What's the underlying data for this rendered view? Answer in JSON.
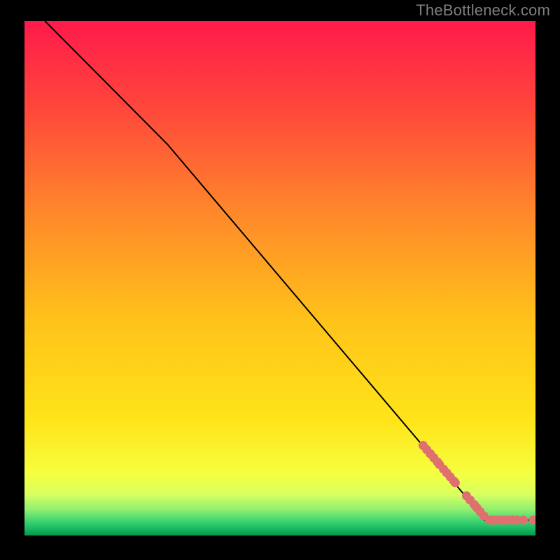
{
  "attribution": "TheBottleneck.com",
  "chart_data": {
    "type": "line",
    "title": "",
    "xlabel": "",
    "ylabel": "",
    "xlim": [
      0,
      100
    ],
    "ylim": [
      0,
      100
    ],
    "gradient_background": {
      "top_color": "#ff1a4b",
      "mid_color": "#ffe000",
      "green_band_start_color": "#e6ff66",
      "green_band_end_color": "#00c060",
      "bottom_color": "#00a050"
    },
    "curve": {
      "color": "#000000",
      "points_xy": [
        [
          4,
          100
        ],
        [
          28,
          76
        ],
        [
          86,
          8
        ],
        [
          90,
          3
        ],
        [
          100,
          3
        ]
      ]
    },
    "series": [
      {
        "name": "markers",
        "color": "#e07070",
        "points_xy": [
          [
            78,
            17.5
          ],
          [
            78.7,
            16.7
          ],
          [
            79.4,
            15.9
          ],
          [
            80.1,
            15.1
          ],
          [
            80.8,
            14.3
          ],
          [
            81.2,
            13.8
          ],
          [
            82.0,
            12.9
          ],
          [
            82.6,
            12.2
          ],
          [
            83.3,
            11.4
          ],
          [
            84.0,
            10.6
          ],
          [
            84.3,
            10.25
          ],
          [
            86.5,
            7.7
          ],
          [
            87.2,
            6.9
          ],
          [
            88.0,
            6.0
          ],
          [
            88.5,
            5.4
          ],
          [
            89.2,
            4.6
          ],
          [
            89.9,
            3.8
          ],
          [
            91.0,
            3.0
          ],
          [
            91.5,
            3.0
          ],
          [
            92.0,
            3.0
          ],
          [
            92.7,
            3.0
          ],
          [
            93.5,
            3.0
          ],
          [
            94.0,
            3.0
          ],
          [
            94.8,
            3.0
          ],
          [
            95.6,
            3.0
          ],
          [
            96.4,
            3.0
          ],
          [
            97.6,
            3.0
          ],
          [
            99.5,
            3.0
          ]
        ]
      }
    ]
  }
}
